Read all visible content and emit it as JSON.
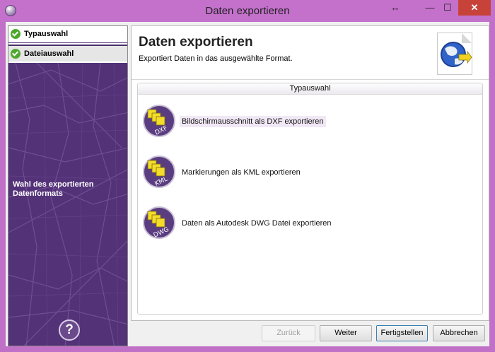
{
  "window": {
    "title": "Daten exportieren",
    "controls": {
      "resize": "↔",
      "minimize": "—",
      "maximize": "☐",
      "close": "✕"
    }
  },
  "steps": [
    {
      "label": "Typauswahl"
    },
    {
      "label": "Dateiauswahl"
    }
  ],
  "left_panel": {
    "description": "Wahl des exportierten Datenformats",
    "help": "?"
  },
  "header": {
    "title": "Daten exportieren",
    "subtitle": "Exportiert Daten in das ausgewählte Format."
  },
  "group": {
    "title": "Typauswahl",
    "options": [
      {
        "label": "Bildschirmausschnitt als DXF exportieren",
        "badge": "DXF",
        "selected": true
      },
      {
        "label": "Markierungen als KML exportieren",
        "badge": "KML",
        "selected": false
      },
      {
        "label": "Daten als Autodesk DWG Datei exportieren",
        "badge": "DWG",
        "selected": false
      }
    ]
  },
  "buttons": {
    "back": "Zurück",
    "next": "Weiter",
    "finish": "Fertigstellen",
    "cancel": "Abbrechen"
  },
  "colors": {
    "accent": "#c471cc",
    "panel": "#5e3a84",
    "check": "#4ea72e",
    "close": "#c7433a"
  }
}
